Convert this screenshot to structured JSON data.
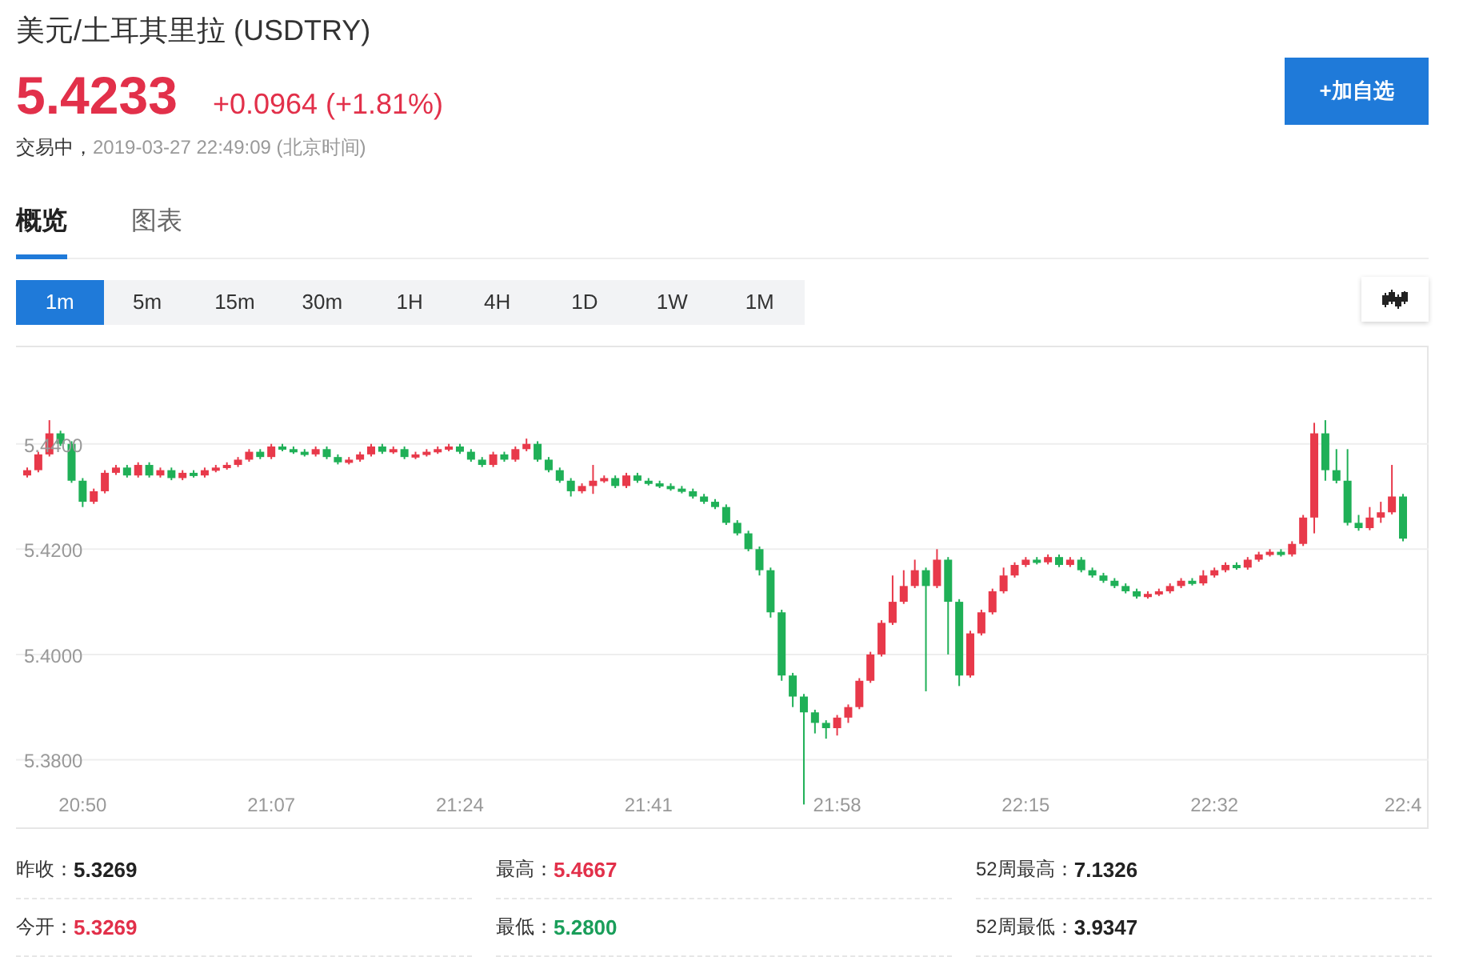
{
  "header": {
    "title": "美元/土耳其里拉 (USDTRY)",
    "price": "5.4233",
    "change": "+0.0964 (+1.81%)",
    "status": "交易中，",
    "timestamp": "2019-03-27 22:49:09 (北京时间)",
    "add_button": "+加自选"
  },
  "tabs": [
    {
      "label": "概览",
      "selected": true
    },
    {
      "label": "图表",
      "selected": false
    }
  ],
  "periods": [
    {
      "label": "1m",
      "selected": true
    },
    {
      "label": "5m",
      "selected": false
    },
    {
      "label": "15m",
      "selected": false
    },
    {
      "label": "30m",
      "selected": false
    },
    {
      "label": "1H",
      "selected": false
    },
    {
      "label": "4H",
      "selected": false
    },
    {
      "label": "1D",
      "selected": false
    },
    {
      "label": "1W",
      "selected": false
    },
    {
      "label": "1M",
      "selected": false
    }
  ],
  "chart": {
    "chart_data": {
      "type": "candlestick",
      "grid": true,
      "ylim": [
        5.367,
        5.4585
      ],
      "yticks": [
        {
          "value": 5.44,
          "label": "5.4400"
        },
        {
          "value": 5.42,
          "label": "5.4200"
        },
        {
          "value": 5.4,
          "label": "5.4000"
        },
        {
          "value": 5.38,
          "label": "5.3800"
        }
      ],
      "categories": [
        null,
        null,
        null,
        null,
        null,
        "20:50",
        null,
        null,
        null,
        null,
        null,
        null,
        null,
        null,
        null,
        null,
        null,
        null,
        null,
        null,
        null,
        null,
        "21:07",
        null,
        null,
        null,
        null,
        null,
        null,
        null,
        null,
        null,
        null,
        null,
        null,
        null,
        null,
        null,
        null,
        "21:24",
        null,
        null,
        null,
        null,
        null,
        null,
        null,
        null,
        null,
        null,
        null,
        null,
        null,
        null,
        null,
        null,
        "21:41",
        null,
        null,
        null,
        null,
        null,
        null,
        null,
        null,
        null,
        null,
        null,
        null,
        null,
        null,
        null,
        null,
        "21:58",
        null,
        null,
        null,
        null,
        null,
        null,
        null,
        null,
        null,
        null,
        null,
        null,
        null,
        null,
        null,
        null,
        "22:15",
        null,
        null,
        null,
        null,
        null,
        null,
        null,
        null,
        null,
        null,
        null,
        null,
        null,
        null,
        null,
        null,
        "22:32",
        null,
        null,
        null,
        null,
        null,
        null,
        null,
        null,
        null,
        null,
        null,
        null,
        null,
        null,
        null,
        null,
        "22:4"
      ],
      "ohlc": [
        [
          5.434,
          5.4355,
          5.4336,
          5.435
        ],
        [
          5.435,
          5.4385,
          5.4346,
          5.438
        ],
        [
          5.438,
          5.4445,
          5.4376,
          5.442
        ],
        [
          5.442,
          5.4425,
          5.4396,
          5.44
        ],
        [
          5.44,
          5.4405,
          5.4326,
          5.433
        ],
        [
          5.433,
          5.4335,
          5.428,
          5.429
        ],
        [
          5.429,
          5.4315,
          5.4286,
          5.431
        ],
        [
          5.431,
          5.435,
          5.4306,
          5.4345
        ],
        [
          5.4345,
          5.436,
          5.4341,
          5.4355
        ],
        [
          5.4355,
          5.436,
          5.4336,
          5.434
        ],
        [
          5.434,
          5.4365,
          5.4336,
          5.436
        ],
        [
          5.436,
          5.4365,
          5.4336,
          5.434
        ],
        [
          5.434,
          5.4355,
          5.4336,
          5.435
        ],
        [
          5.435,
          5.4355,
          5.4331,
          5.4335
        ],
        [
          5.4335,
          5.435,
          5.4331,
          5.4345
        ],
        [
          5.4345,
          5.435,
          5.4336,
          5.434
        ],
        [
          5.434,
          5.4355,
          5.4336,
          5.435
        ],
        [
          5.435,
          5.436,
          5.4346,
          5.4355
        ],
        [
          5.4355,
          5.4365,
          5.4351,
          5.436
        ],
        [
          5.436,
          5.4375,
          5.4356,
          5.437
        ],
        [
          5.437,
          5.439,
          5.4366,
          5.4385
        ],
        [
          5.4385,
          5.439,
          5.4371,
          5.4375
        ],
        [
          5.4375,
          5.44,
          5.4371,
          5.4395
        ],
        [
          5.4395,
          5.44,
          5.4386,
          5.439
        ],
        [
          5.439,
          5.4395,
          5.4381,
          5.4385
        ],
        [
          5.4385,
          5.439,
          5.4376,
          5.438
        ],
        [
          5.438,
          5.4395,
          5.4376,
          5.439
        ],
        [
          5.439,
          5.4395,
          5.4371,
          5.4375
        ],
        [
          5.4375,
          5.438,
          5.4361,
          5.4365
        ],
        [
          5.4365,
          5.4375,
          5.4361,
          5.437
        ],
        [
          5.437,
          5.4385,
          5.4366,
          5.438
        ],
        [
          5.438,
          5.44,
          5.4376,
          5.4395
        ],
        [
          5.4395,
          5.44,
          5.4381,
          5.4385
        ],
        [
          5.4385,
          5.4395,
          5.4381,
          5.439
        ],
        [
          5.439,
          5.4395,
          5.4371,
          5.4375
        ],
        [
          5.4375,
          5.4385,
          5.4371,
          5.438
        ],
        [
          5.438,
          5.439,
          5.4376,
          5.4385
        ],
        [
          5.4385,
          5.4395,
          5.4381,
          5.439
        ],
        [
          5.439,
          5.44,
          5.4386,
          5.4395
        ],
        [
          5.4395,
          5.44,
          5.4381,
          5.4385
        ],
        [
          5.4385,
          5.439,
          5.4366,
          5.437
        ],
        [
          5.437,
          5.4375,
          5.4356,
          5.436
        ],
        [
          5.436,
          5.4385,
          5.4356,
          5.438
        ],
        [
          5.438,
          5.4385,
          5.4366,
          5.437
        ],
        [
          5.437,
          5.4395,
          5.4366,
          5.439
        ],
        [
          5.439,
          5.441,
          5.4386,
          5.44
        ],
        [
          5.44,
          5.4405,
          5.4366,
          5.437
        ],
        [
          5.437,
          5.4375,
          5.4346,
          5.435
        ],
        [
          5.435,
          5.4355,
          5.4326,
          5.433
        ],
        [
          5.433,
          5.4335,
          5.43,
          5.431
        ],
        [
          5.431,
          5.4325,
          5.4306,
          5.432
        ],
        [
          5.432,
          5.436,
          5.4305,
          5.433
        ],
        [
          5.433,
          5.434,
          5.4326,
          5.4335
        ],
        [
          5.4335,
          5.434,
          5.4316,
          5.432
        ],
        [
          5.432,
          5.4345,
          5.4316,
          5.434
        ],
        [
          5.434,
          5.4345,
          5.4326,
          5.433
        ],
        [
          5.433,
          5.4335,
          5.4321,
          5.4325
        ],
        [
          5.4325,
          5.433,
          5.4316,
          5.432
        ],
        [
          5.432,
          5.4325,
          5.4311,
          5.4315
        ],
        [
          5.4315,
          5.432,
          5.4306,
          5.431
        ],
        [
          5.431,
          5.4315,
          5.4296,
          5.43
        ],
        [
          5.43,
          5.4305,
          5.4286,
          5.429
        ],
        [
          5.429,
          5.4295,
          5.4276,
          5.428
        ],
        [
          5.428,
          5.4285,
          5.4246,
          5.425
        ],
        [
          5.425,
          5.4255,
          5.4226,
          5.423
        ],
        [
          5.423,
          5.4235,
          5.4196,
          5.42
        ],
        [
          5.42,
          5.4205,
          5.415,
          5.416
        ],
        [
          5.416,
          5.4165,
          5.407,
          5.408
        ],
        [
          5.408,
          5.4085,
          5.395,
          5.396
        ],
        [
          5.396,
          5.3965,
          5.39,
          5.392
        ],
        [
          5.392,
          5.3925,
          5.3715,
          5.389
        ],
        [
          5.389,
          5.3895,
          5.385,
          5.387
        ],
        [
          5.387,
          5.3875,
          5.384,
          5.386
        ],
        [
          5.386,
          5.3885,
          5.3846,
          5.388
        ],
        [
          5.388,
          5.3905,
          5.387,
          5.39
        ],
        [
          5.39,
          5.3955,
          5.3896,
          5.395
        ],
        [
          5.395,
          5.4005,
          5.3946,
          5.4
        ],
        [
          5.4,
          5.4065,
          5.3996,
          5.406
        ],
        [
          5.406,
          5.415,
          5.4056,
          5.41
        ],
        [
          5.41,
          5.416,
          5.4096,
          5.413
        ],
        [
          5.413,
          5.418,
          5.4126,
          5.416
        ],
        [
          5.416,
          5.4165,
          5.393,
          5.413
        ],
        [
          5.413,
          5.42,
          5.4126,
          5.418
        ],
        [
          5.418,
          5.4185,
          5.4,
          5.41
        ],
        [
          5.41,
          5.4105,
          5.394,
          5.396
        ],
        [
          5.396,
          5.4045,
          5.3956,
          5.404
        ],
        [
          5.404,
          5.4085,
          5.4036,
          5.408
        ],
        [
          5.408,
          5.4125,
          5.4076,
          5.412
        ],
        [
          5.412,
          5.4165,
          5.4116,
          5.415
        ],
        [
          5.415,
          5.4175,
          5.4146,
          5.417
        ],
        [
          5.417,
          5.4185,
          5.4166,
          5.418
        ],
        [
          5.418,
          5.4185,
          5.4171,
          5.4175
        ],
        [
          5.4175,
          5.419,
          5.4171,
          5.4185
        ],
        [
          5.4185,
          5.419,
          5.4166,
          5.417
        ],
        [
          5.417,
          5.4185,
          5.4166,
          5.418
        ],
        [
          5.418,
          5.4185,
          5.4156,
          5.416
        ],
        [
          5.416,
          5.4165,
          5.4146,
          5.415
        ],
        [
          5.415,
          5.4155,
          5.4136,
          5.414
        ],
        [
          5.414,
          5.4145,
          5.4126,
          5.413
        ],
        [
          5.413,
          5.4135,
          5.4116,
          5.412
        ],
        [
          5.412,
          5.4125,
          5.4106,
          5.411
        ],
        [
          5.411,
          5.412,
          5.4106,
          5.4115
        ],
        [
          5.4115,
          5.4125,
          5.4111,
          5.412
        ],
        [
          5.412,
          5.4135,
          5.4116,
          5.413
        ],
        [
          5.413,
          5.4145,
          5.4126,
          5.414
        ],
        [
          5.414,
          5.4145,
          5.4131,
          5.4135
        ],
        [
          5.4135,
          5.416,
          5.4131,
          5.415
        ],
        [
          5.415,
          5.4165,
          5.4146,
          5.416
        ],
        [
          5.416,
          5.4175,
          5.4156,
          5.417
        ],
        [
          5.417,
          5.4175,
          5.4161,
          5.4165
        ],
        [
          5.4165,
          5.4185,
          5.4161,
          5.418
        ],
        [
          5.418,
          5.4195,
          5.4176,
          5.419
        ],
        [
          5.419,
          5.42,
          5.4186,
          5.4195
        ],
        [
          5.4195,
          5.42,
          5.4186,
          5.419
        ],
        [
          5.419,
          5.4215,
          5.4186,
          5.421
        ],
        [
          5.421,
          5.4265,
          5.4206,
          5.426
        ],
        [
          5.426,
          5.444,
          5.423,
          5.442
        ],
        [
          5.442,
          5.4445,
          5.433,
          5.435
        ],
        [
          5.435,
          5.439,
          5.4325,
          5.433
        ],
        [
          5.433,
          5.439,
          5.4245,
          5.425
        ],
        [
          5.425,
          5.4265,
          5.4235,
          5.424
        ],
        [
          5.424,
          5.428,
          5.4236,
          5.426
        ],
        [
          5.426,
          5.429,
          5.425,
          5.427
        ],
        [
          5.427,
          5.436,
          5.4266,
          5.43
        ],
        [
          5.43,
          5.4305,
          5.4215,
          5.422
        ]
      ]
    }
  },
  "stats": [
    {
      "label": "昨收：",
      "value": "5.3269",
      "color": "#222222"
    },
    {
      "label": "最高：",
      "value": "5.4667",
      "color": "#e2304a"
    },
    {
      "label": "52周最高：",
      "value": "7.1326",
      "color": "#222222"
    },
    {
      "label": "今开：",
      "value": "5.3269",
      "color": "#e2304a"
    },
    {
      "label": "最低：",
      "value": "5.2800",
      "color": "#1a9e5a"
    },
    {
      "label": "52周最低：",
      "value": "3.9347",
      "color": "#222222"
    }
  ]
}
